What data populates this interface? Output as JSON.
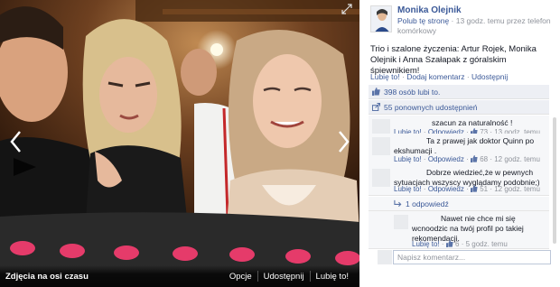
{
  "stage": {
    "album_link": "Zdjęcia na osi czasu",
    "actions": [
      "Opcje",
      "Udostępnij",
      "Lubię to!"
    ]
  },
  "post": {
    "owner_name": "Monika Olejnik",
    "owner_meta_link": "Polub tę stronę",
    "owner_meta_text": " · 13 godz. temu przez telefon komórkowy",
    "caption": "Trio i szalone życzenia: Artur Rojek, Monika Olejnik i Anna Szałapak z góralskim śpiewnikiem!",
    "actions": [
      "Lubię to!",
      "Dodaj komentarz",
      "Udostępnij"
    ],
    "likes_text": "398 osób lubi to.",
    "shares_text": "55 ponownych udostępnień"
  },
  "comments": [
    {
      "text": "szacun za naturalność !",
      "like": "Lubię to!",
      "reply": "Odpowiedz",
      "likes": "73",
      "time": "13 godz. temu"
    },
    {
      "text": "Ta z prawej jak doktor Quinn po ekshumacji .",
      "like": "Lubię to!",
      "reply": "Odpowiedz",
      "likes": "68",
      "time": "12 godz. temu"
    },
    {
      "text": "Dobrze wiedzieć,że w pewnych sytuacjach wszyscy wyglądamy podobnie;)",
      "like": "Lubię to!",
      "reply": "Odpowiedz",
      "likes": "51",
      "time": "12 godz. temu"
    }
  ],
  "replies_toggle": "1 odpowiedź",
  "reply": {
    "text": "Nawet nie chce mi się wcnoodzic na twój profil po takiej rekomendacji.",
    "like": "Lubię to!",
    "likes": "6",
    "time": "5 godz. temu"
  },
  "comment_box": {
    "placeholder": "Napisz komentarz..."
  },
  "colors": {
    "link": "#3b5998",
    "meta": "#90949c",
    "ufi_bg": "#edeff4"
  }
}
